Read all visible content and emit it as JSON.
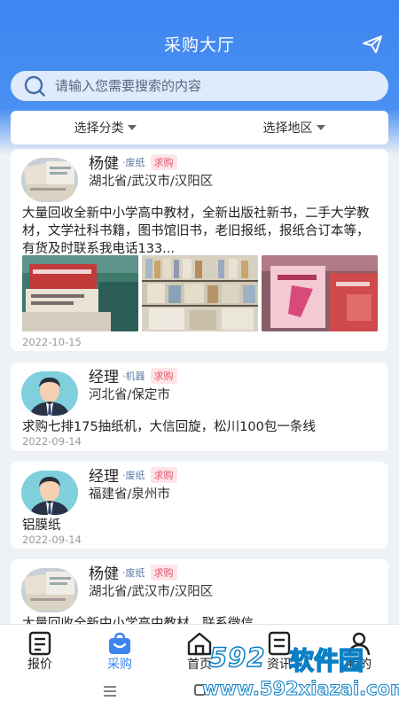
{
  "header": {
    "title": "采购大厅",
    "send_icon": "paper-plane-icon"
  },
  "search": {
    "placeholder": "请输入您需要搜索的内容",
    "value": ""
  },
  "filters": [
    {
      "label": "选择分类",
      "icon": "caret-down-icon"
    },
    {
      "label": "选择地区",
      "icon": "caret-down-icon"
    }
  ],
  "listings": [
    {
      "name": "杨健",
      "category": "废纸",
      "tag": "求购",
      "location": "湖北省/武汉市/汉阳区",
      "description": "大量回收全新中小学高中教材，全新出版社新书，二手大学教材，文学社科书籍，图书馆旧书，老旧报纸，报纸合订本等，有货及时联系我电话133...",
      "date": "2022-10-15",
      "photos": [
        "book-stack-photo",
        "bookshelf-photo",
        "textbook-pile-photo"
      ]
    },
    {
      "name": "经理",
      "category": "机器",
      "tag": "求购",
      "location": "河北省/保定市",
      "description": "求购七排175抽纸机，大信回旋，松川100包一条线",
      "date": "2022-09-14"
    },
    {
      "name": "经理",
      "category": "废纸",
      "tag": "求购",
      "location": "福建省/泉州市",
      "description": "铝膜纸",
      "date": "2022-09-14"
    },
    {
      "name": "杨健",
      "category": "废纸",
      "tag": "求购",
      "location": "湖北省/武汉市/汉阳区",
      "description": "大量回收全新中小学高中教材，联系微信"
    }
  ],
  "tabbar": [
    {
      "label": "报价",
      "icon": "document-icon",
      "active": false
    },
    {
      "label": "采购",
      "icon": "shopping-bag-icon",
      "active": true
    },
    {
      "label": "首页",
      "icon": "home-icon",
      "active": false
    },
    {
      "label": "资讯",
      "icon": "news-icon",
      "active": false
    },
    {
      "label": "我的",
      "icon": "user-icon",
      "active": false
    }
  ],
  "watermark": {
    "logo": "592",
    "brand": "软件园",
    "url": "www.592xiazai.com"
  },
  "colors": {
    "primary": "#3d85f0",
    "tag_text": "#e4566b",
    "tag_bg": "#fde5e8",
    "category": "#5e7ca5",
    "date": "#9a9a9a"
  }
}
